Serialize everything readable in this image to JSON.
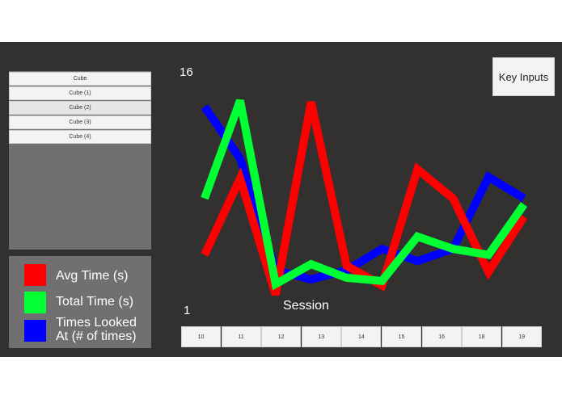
{
  "cube_list": [
    "Cube",
    "Cube (1)",
    "Cube (2)",
    "Cube (3)",
    "Cube (4)"
  ],
  "legend": [
    {
      "label": "Avg Time (s)",
      "color": "#ff0000"
    },
    {
      "label": "Total Time (s)",
      "color": "#00ff33"
    },
    {
      "label": "Times Looked At (# of times)",
      "color": "#0000ff"
    }
  ],
  "key_inputs_label": "Key Inputs",
  "chart_data": {
    "type": "line",
    "xlabel": "Session",
    "ylim_labels": {
      "max": "16",
      "min": "1"
    },
    "ylim": [
      1,
      16
    ],
    "categories": [
      "10",
      "11",
      "12",
      "13",
      "14",
      "15",
      "16",
      "18",
      "19"
    ],
    "series": [
      {
        "name": "Avg Time (s)",
        "color": "#ff0000",
        "values": [
          4.4,
          9.4,
          1.8,
          14.4,
          3.7,
          2.4,
          10.0,
          8.1,
          3.3,
          6.9
        ]
      },
      {
        "name": "Total Time (s)",
        "color": "#00ff33",
        "values": [
          8.1,
          14.5,
          2.5,
          3.8,
          2.9,
          2.7,
          5.6,
          4.8,
          4.4,
          7.7
        ]
      },
      {
        "name": "Times Looked At (# of times)",
        "color": "#0000ff",
        "values": [
          14.1,
          10.7,
          3.4,
          2.8,
          3.4,
          4.8,
          4.0,
          4.8,
          9.5,
          8.1
        ]
      }
    ]
  }
}
